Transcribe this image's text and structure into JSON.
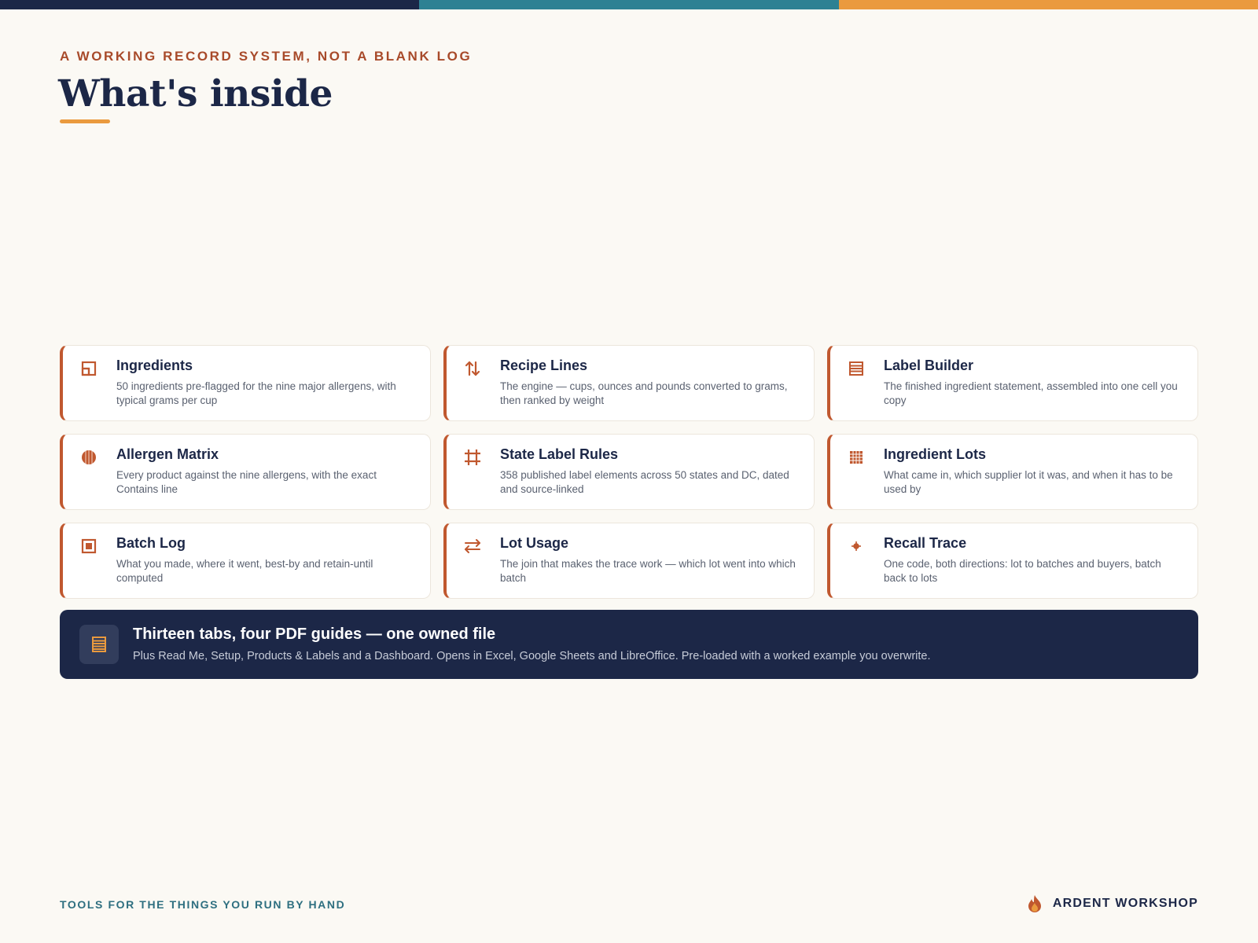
{
  "colors": {
    "navy": "#1c2747",
    "teal": "#2e8193",
    "orange": "#ea9a3e",
    "rust": "#c0582f",
    "background": "#fbf9f4"
  },
  "header": {
    "eyebrow": "A WORKING RECORD SYSTEM, NOT A BLANK LOG",
    "title": "What's inside"
  },
  "cards": [
    {
      "icon": "layout-square-icon",
      "title": "Ingredients",
      "desc": "50 ingredients pre-flagged for the nine major allergens, with typical grams per cup"
    },
    {
      "icon": "sort-arrows-icon",
      "title": "Recipe Lines",
      "desc": "The engine — cups, ounces and pounds converted to grams, then ranked by weight"
    },
    {
      "icon": "list-box-icon",
      "title": "Label Builder",
      "desc": "The finished ingredient statement, assembled into one cell you copy"
    },
    {
      "icon": "striped-circle-icon",
      "title": "Allergen Matrix",
      "desc": "Every product against the nine allergens, with the exact Contains line"
    },
    {
      "icon": "hash-grid-icon",
      "title": "State Label Rules",
      "desc": "358 published label elements across 50 states and DC, dated and source-linked"
    },
    {
      "icon": "dense-grid-icon",
      "title": "Ingredient Lots",
      "desc": "What came in, which supplier lot it was, and when it has to be used by"
    },
    {
      "icon": "boxed-square-icon",
      "title": "Batch Log",
      "desc": "What you made, where it went, best-by and retain-until computed"
    },
    {
      "icon": "swap-arrows-icon",
      "title": "Lot Usage",
      "desc": "The join that makes the trace work — which lot went into which batch"
    },
    {
      "icon": "crosshair-icon",
      "title": "Recall Trace",
      "desc": "One code, both directions: lot to batches and buyers, batch back to lots"
    }
  ],
  "banner": {
    "icon": "document-lines-icon",
    "title": "Thirteen tabs, four PDF guides — one owned file",
    "desc": "Plus Read Me, Setup, Products & Labels and a Dashboard. Opens in Excel, Google Sheets and LibreOffice. Pre-loaded with a worked example you overwrite."
  },
  "footer": {
    "tagline": "TOOLS FOR THE THINGS YOU RUN BY HAND",
    "logo_icon": "flame-icon",
    "brand": "ARDENT WORKSHOP"
  }
}
